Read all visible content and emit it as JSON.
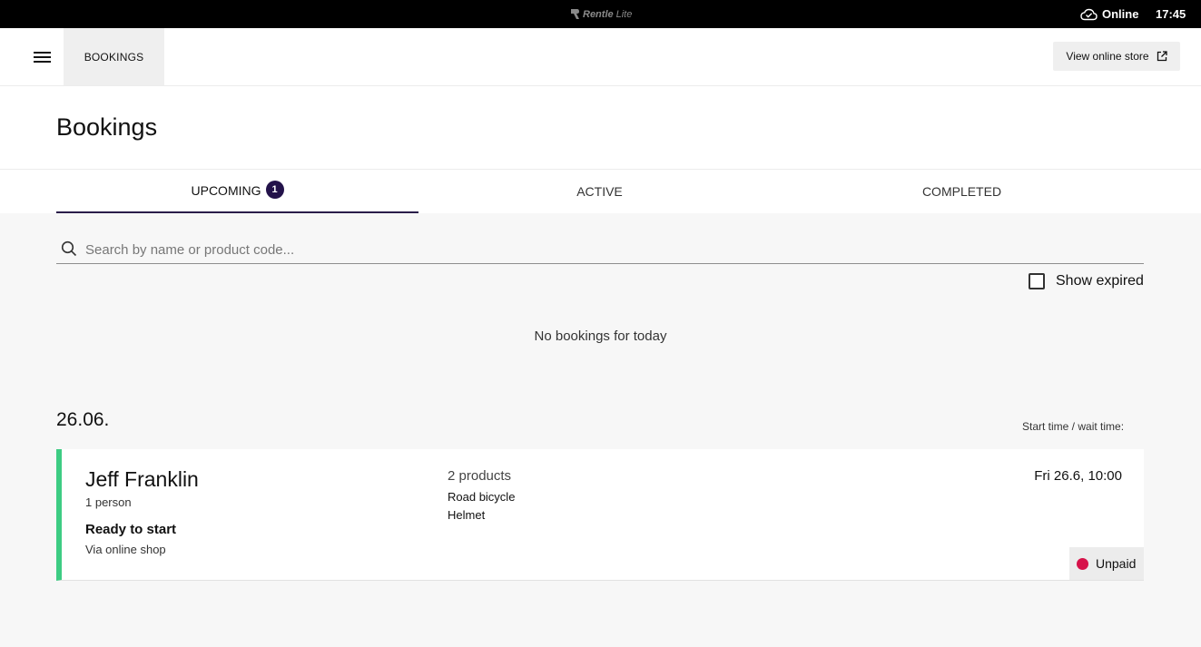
{
  "system_bar": {
    "brand": "Rentle",
    "brand_suffix": "Lite",
    "connection_status": "Online",
    "connection_icon": "cloud-check-icon",
    "time": "17:45"
  },
  "header": {
    "menu_icon": "hamburger-menu-icon",
    "nav_tab": "BOOKINGS",
    "store_button": "View online store",
    "store_button_icon": "external-link-icon"
  },
  "page": {
    "title": "Bookings"
  },
  "tabs": [
    {
      "label": "UPCOMING",
      "badge": "1",
      "active": true
    },
    {
      "label": "ACTIVE",
      "active": false
    },
    {
      "label": "COMPLETED",
      "active": false
    }
  ],
  "search": {
    "placeholder": "Search by name or product code...",
    "value": "",
    "icon": "search-icon"
  },
  "filters": {
    "show_expired_label": "Show expired",
    "show_expired_checked": false
  },
  "today": {
    "empty_message": "No bookings for today"
  },
  "groups": [
    {
      "date": "26.06.",
      "column_label": "Start time / wait time:",
      "bookings": [
        {
          "name": "Jeff Franklin",
          "persons": "1 person",
          "state": "Ready to start",
          "source": "Via online shop",
          "product_count": "2 products",
          "products": [
            "Road bicycle",
            "Helmet"
          ],
          "start": "Fri 26.6, 10:00",
          "payment_status": "Unpaid"
        }
      ]
    }
  ],
  "colors": {
    "accent": "#23124a",
    "status_ready": "#3dcc83",
    "unpaid_dot": "#d6134a"
  }
}
